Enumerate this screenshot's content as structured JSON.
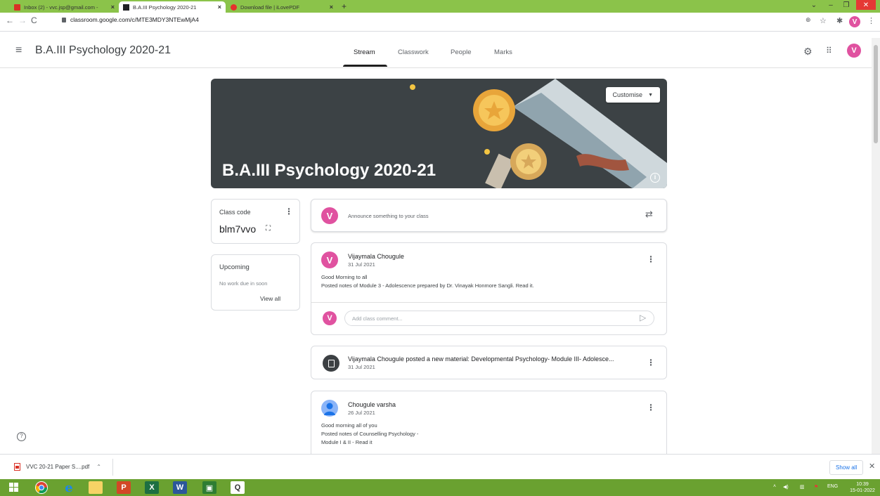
{
  "browser": {
    "tabs": [
      {
        "label": "Inbox (2) - vvc.jsp@gmail.com - ",
        "fav_color": "#d93025"
      },
      {
        "label": "B.A.III Psychology 2020-21",
        "fav_color": "#202124"
      },
      {
        "label": "Download file | iLovePDF",
        "fav_color": "#e5322d"
      }
    ],
    "url": "classroom.google.com/c/MTE3MDY3NTEwMjA4",
    "profile_initial": "V"
  },
  "header": {
    "class_title": "B.A.III Psychology 2020-21",
    "tabs": [
      "Stream",
      "Classwork",
      "People",
      "Marks"
    ],
    "profile_initial": "V"
  },
  "banner": {
    "title": "B.A.III Psychology 2020-21",
    "customise_label": "Customise"
  },
  "class_code": {
    "label": "Class code",
    "code": "blm7vvo"
  },
  "upcoming": {
    "title": "Upcoming",
    "empty_text": "No work due in soon",
    "view_all": "View all"
  },
  "announce": {
    "avatar": "V",
    "placeholder": "Announce something to your class"
  },
  "posts": [
    {
      "avatar": "V",
      "author": "Vijaymala Chougule",
      "date": "31 Jul 2021",
      "line1": "Good Morning to all",
      "line2": "Posted notes of Module 3 - Adolescence prepared by Dr. Vinayak Honmore Sangli. Read it.",
      "comment_placeholder": "Add class comment..."
    },
    {
      "title": "Vijaymala Chougule posted a new material: Developmental Psychology- Module III- Adolesce...",
      "date": "31 Jul 2021"
    },
    {
      "author": "Chougule varsha",
      "date": "26 Jul 2021",
      "line1": "Good morning all of you",
      "line2": "Posted notes of Counselling Psychology -",
      "line3": "Module I & II - Read it"
    }
  ],
  "download_bar": {
    "file": "VVC 20-21 Paper S....pdf",
    "show_all": "Show all"
  },
  "taskbar": {
    "language": "ENG",
    "time": "10:39",
    "date": "15-01-2022"
  }
}
